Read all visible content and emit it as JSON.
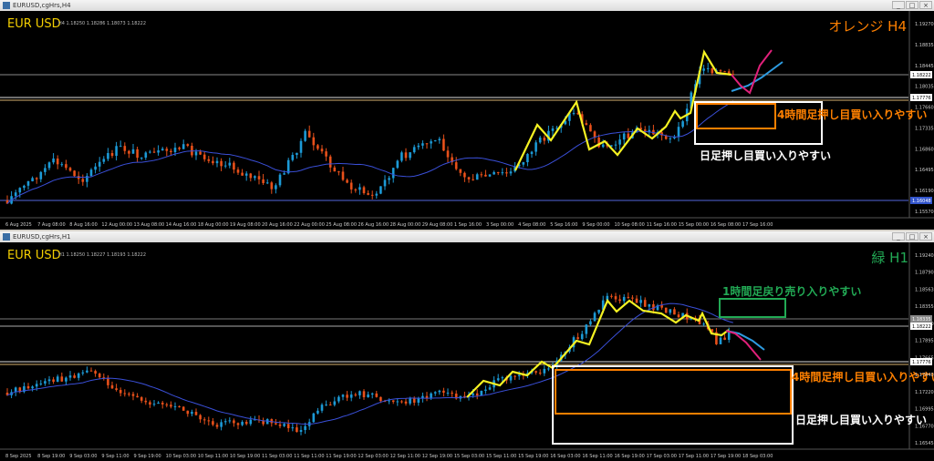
{
  "colors": {
    "bull": "#1c9ad6",
    "bear": "#e8501a",
    "ma": "#3a4fd8",
    "zigzag": "#f5f222",
    "forecast_up": "#2d9be0",
    "forecast_down": "#e0207a",
    "orange": "#ff8000",
    "green": "#22aa55",
    "white": "#ffffff"
  },
  "top_chart": {
    "window_title": "EURUSD,cgHrs,H4",
    "window_buttons": [
      "_",
      "□",
      "×"
    ],
    "symbol": "EUR USD",
    "ohlc": "H4 1.18250 1.18286 1.18073 1.18222",
    "corner_label": "オレンジ H4",
    "box_h4_label": "4時間足押し目買い入りやすい",
    "box_d1_label": "日足押し目買い入りやすい",
    "price_ticks": [
      "1.19270",
      "1.18835",
      "1.18445",
      "1.18035",
      "1.17660",
      "1.17335",
      "1.16860",
      "1.16495",
      "1.16190",
      "1.15570"
    ],
    "price_tags": [
      "1.18222",
      "1.17776",
      "1.16048"
    ],
    "time_ticks": [
      "6 Aug 2025",
      "7 Aug 08:00",
      "8 Aug 16:00",
      "12 Aug 00:00",
      "13 Aug 08:00",
      "14 Aug 16:00",
      "18 Aug 00:00",
      "19 Aug 08:00",
      "20 Aug 16:00",
      "22 Aug 00:00",
      "25 Aug 08:00",
      "26 Aug 16:00",
      "28 Aug 00:00",
      "29 Aug 08:00",
      "1 Sep 16:00",
      "3 Sep 00:00",
      "4 Sep 08:00",
      "5 Sep 16:00",
      "9 Sep 00:00",
      "10 Sep 08:00",
      "11 Sep 16:00",
      "15 Sep 00:00",
      "16 Sep 08:00",
      "17 Sep 16:00"
    ]
  },
  "bottom_chart": {
    "window_title": "EURUSD,cgHrs,H1",
    "window_buttons": [
      "_",
      "□",
      "×"
    ],
    "symbol": "EUR USD",
    "ohlc": "H1 1.18250 1.18227 1.18193 1.18222",
    "corner_label": "緑 H1",
    "box_h1_label": "1時間足戻り売り入りやすい",
    "box_h4_label": "4時間足押し目買い入りやすい",
    "box_d1_label": "日足押し目買い入りやすい",
    "price_ticks": [
      "1.19240",
      "1.18790",
      "1.18563",
      "1.18355",
      "1.18120",
      "1.17895",
      "1.17665",
      "1.17440",
      "1.17220",
      "1.16995",
      "1.16770",
      "1.16545"
    ],
    "price_tags": [
      "1.18335",
      "1.18222",
      "1.17776"
    ],
    "time_ticks": [
      "8 Sep 2025",
      "8 Sep 19:00",
      "9 Sep 03:00",
      "9 Sep 11:00",
      "9 Sep 19:00",
      "10 Sep 03:00",
      "10 Sep 11:00",
      "10 Sep 19:00",
      "11 Sep 03:00",
      "11 Sep 11:00",
      "11 Sep 19:00",
      "12 Sep 03:00",
      "12 Sep 11:00",
      "12 Sep 19:00",
      "15 Sep 03:00",
      "15 Sep 11:00",
      "15 Sep 19:00",
      "16 Sep 03:00",
      "16 Sep 11:00",
      "16 Sep 19:00",
      "17 Sep 03:00",
      "17 Sep 11:00",
      "17 Sep 19:00",
      "18 Sep 03:00"
    ]
  }
}
